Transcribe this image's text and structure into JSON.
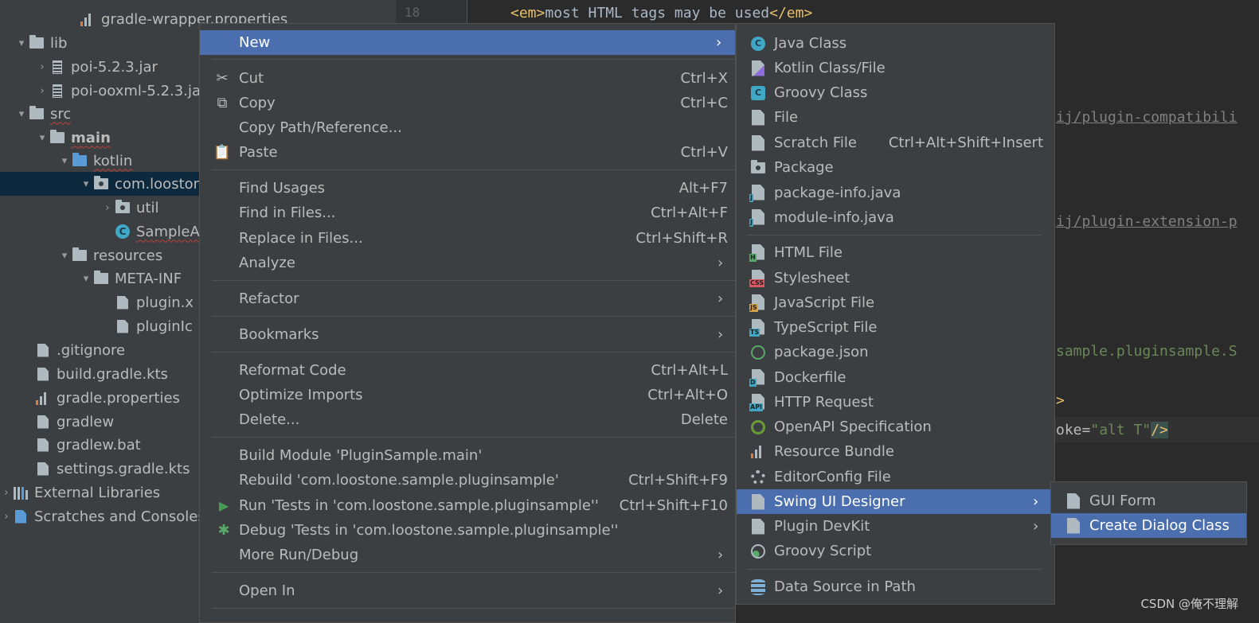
{
  "editor": {
    "line_number": "18",
    "line18": {
      "open": "<em>",
      "text": "most HTML tags may be used",
      "close": "</em>"
    },
    "link1": "ij/plugin-compatibili",
    "link2": "ij/plugin-extension-p",
    "frag3": "sample.pluginsample.S",
    "frag4_attr": "oke=",
    "frag4_value": "\"alt T\"",
    "frag4_end": "/>",
    "frag5": ">"
  },
  "tree": {
    "items": [
      {
        "label": "gradle-wrapper.properties",
        "icon": "properties-file-icon"
      },
      {
        "label": "lib",
        "icon": "folder-icon"
      },
      {
        "label": "poi-5.2.3.jar",
        "icon": "jar-icon"
      },
      {
        "label": "poi-ooxml-5.2.3.ja",
        "icon": "jar-icon"
      },
      {
        "label": "src",
        "icon": "folder-icon"
      },
      {
        "label": "main",
        "icon": "module-folder-icon"
      },
      {
        "label": "kotlin",
        "icon": "source-folder-icon"
      },
      {
        "label": "com.looston",
        "icon": "package-icon"
      },
      {
        "label": "util",
        "icon": "package-icon"
      },
      {
        "label": "SampleA",
        "icon": "kotlin-class-icon"
      },
      {
        "label": "resources",
        "icon": "resources-folder-icon"
      },
      {
        "label": "META-INF",
        "icon": "folder-icon"
      },
      {
        "label": "plugin.x",
        "icon": "plugin-xml-icon"
      },
      {
        "label": "pluginIc",
        "icon": "image-file-icon"
      },
      {
        "label": ".gitignore",
        "icon": "gitignore-icon"
      },
      {
        "label": "build.gradle.kts",
        "icon": "gradle-kts-icon"
      },
      {
        "label": "gradle.properties",
        "icon": "properties-file-icon"
      },
      {
        "label": "gradlew",
        "icon": "shell-file-icon"
      },
      {
        "label": "gradlew.bat",
        "icon": "bat-file-icon"
      },
      {
        "label": "settings.gradle.kts",
        "icon": "gradle-kts-icon"
      },
      {
        "label": "External Libraries",
        "icon": "libraries-icon"
      },
      {
        "label": "Scratches and Consoles",
        "icon": "scratches-icon"
      }
    ]
  },
  "context_menu": {
    "new": "New",
    "cut": "Cut",
    "cut_sc": "Ctrl+X",
    "copy": "Copy",
    "copy_sc": "Ctrl+C",
    "copy_path": "Copy Path/Reference...",
    "paste": "Paste",
    "paste_sc": "Ctrl+V",
    "find_usages": "Find Usages",
    "find_usages_sc": "Alt+F7",
    "find_in_files": "Find in Files...",
    "find_in_files_sc": "Ctrl+Alt+F",
    "replace_in_files": "Replace in Files...",
    "replace_in_files_sc": "Ctrl+Shift+R",
    "analyze": "Analyze",
    "refactor": "Refactor",
    "bookmarks": "Bookmarks",
    "reformat_code": "Reformat Code",
    "reformat_code_sc": "Ctrl+Alt+L",
    "optimize_imports": "Optimize Imports",
    "optimize_imports_sc": "Ctrl+Alt+O",
    "delete": "Delete...",
    "delete_sc": "Delete",
    "build_module": "Build Module 'PluginSample.main'",
    "rebuild": "Rebuild 'com.loostone.sample.pluginsample'",
    "rebuild_sc": "Ctrl+Shift+F9",
    "run": "Run 'Tests in 'com.loostone.sample.pluginsample''",
    "run_sc": "Ctrl+Shift+F10",
    "debug": "Debug 'Tests in 'com.loostone.sample.pluginsample''",
    "more_run": "More Run/Debug",
    "open_in": "Open In"
  },
  "new_submenu": {
    "java_class": "Java Class",
    "kotlin_class": "Kotlin Class/File",
    "groovy_class": "Groovy Class",
    "file": "File",
    "scratch_file": "Scratch File",
    "scratch_file_sc": "Ctrl+Alt+Shift+Insert",
    "package": "Package",
    "package_info": "package-info.java",
    "module_info": "module-info.java",
    "html_file": "HTML File",
    "stylesheet": "Stylesheet",
    "javascript_file": "JavaScript File",
    "typescript_file": "TypeScript File",
    "package_json": "package.json",
    "dockerfile": "Dockerfile",
    "http_request": "HTTP Request",
    "openapi": "OpenAPI Specification",
    "resource_bundle": "Resource Bundle",
    "editorconfig": "EditorConfig File",
    "swing_ui_designer": "Swing UI Designer",
    "plugin_devkit": "Plugin DevKit",
    "groovy_script": "Groovy Script",
    "data_source": "Data Source in Path"
  },
  "swing_submenu": {
    "gui_form": "GUI Form",
    "create_dialog_class": "Create Dialog Class"
  },
  "watermark": "CSDN @俺不理解",
  "colors": {
    "highlight": "#4b6eaf",
    "menu_bg": "#3c3f41",
    "tree_selected": "#0d293e"
  }
}
